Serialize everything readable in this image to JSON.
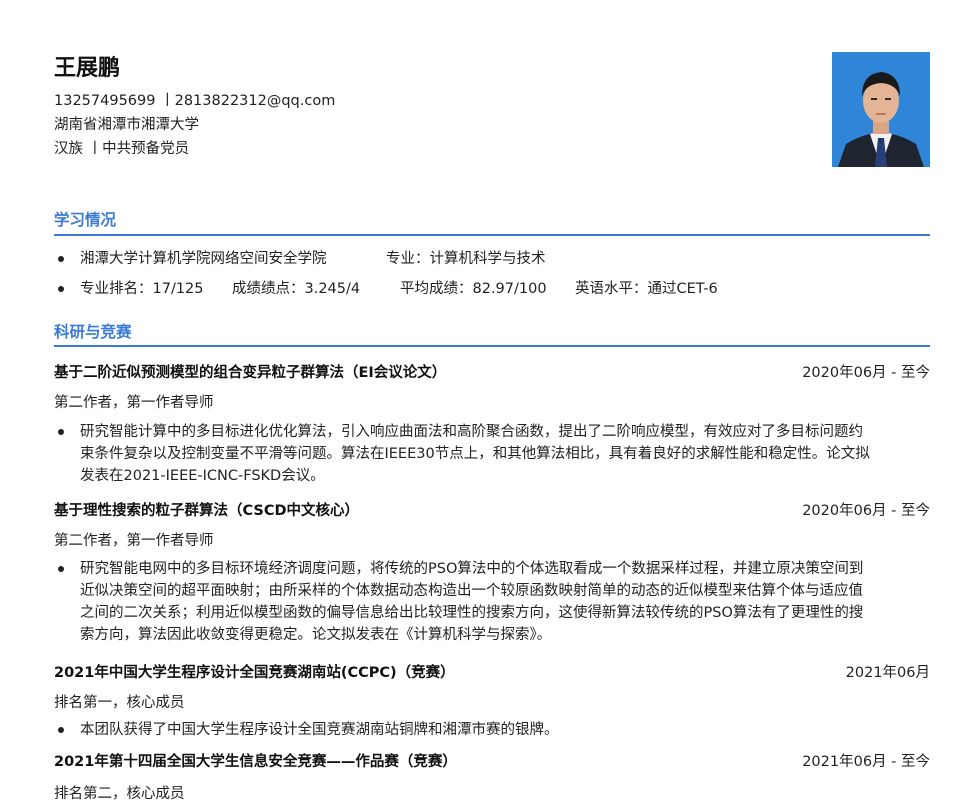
{
  "header": {
    "name": "王展鹏",
    "contact": "13257495699 丨2813822312@qq.com",
    "address": "湖南省湘潭市湘潭大学",
    "identity": "汉族 丨中共预备党员"
  },
  "education": {
    "title": "学习情况",
    "school": "湘潭大学计算机学院网络空间安全学院",
    "major": "专业：计算机科学与技术",
    "rank": "专业排名：17/125",
    "gpa": "成绩绩点：3.245/4",
    "avg": "平均成绩：82.97/100",
    "english": "英语水平：通过CET-6"
  },
  "research": {
    "title": "科研与竞赛",
    "items": [
      {
        "title": "基于二阶近似预测模型的组合变异粒子群算法（EI会议论文）",
        "date": "2020年06月 - 至今",
        "role": "第二作者，第一作者导师",
        "desc_lines": [
          "研究智能计算中的多目标进化优化算法，引入响应曲面法和高阶聚合函数，提出了二阶响应模型，有效应对了多目标问题约",
          "束条件复杂以及控制变量不平滑等问题。算法在IEEE30节点上，和其他算法相比，具有着良好的求解性能和稳定性。论文拟",
          "发表在2021-IEEE-ICNC-FSKD会议。"
        ]
      },
      {
        "title": "基于理性搜索的粒子群算法（CSCD中文核心）",
        "date": "2020年06月 - 至今",
        "role": "第二作者，第一作者导师",
        "desc_lines": [
          "研究智能电网中的多目标环境经济调度问题，将传统的PSO算法中的个体选取看成一个数据采样过程，并建立原决策空间到",
          "近似决策空间的超平面映射；由所采样的个体数据动态构造出一个较原函数映射简单的动态的近似模型来估算个体与适应值",
          "之间的二次关系；利用近似模型函数的偏导信息给出比较理性的搜索方向，这使得新算法较传统的PSO算法有了更理性的搜",
          "索方向，算法因此收敛变得更稳定。论文拟发表在《计算机科学与探索》。"
        ]
      },
      {
        "title": "2021年中国大学生程序设计全国竞赛湖南站(CCPC)（竞赛）",
        "date": "2021年06月",
        "role": "排名第一，核心成员",
        "desc_lines": [
          "本团队获得了中国大学生程序设计全国竞赛湖南站铜牌和湘潭市赛的银牌。"
        ]
      },
      {
        "title": "2021年第十四届全国大学生信息安全竞赛——作品赛（竞赛）",
        "date": "2021年06月 - 至今",
        "role": "排名第二，核心成员",
        "desc_lines": []
      }
    ]
  },
  "colors": {
    "accent": "#3a7bd5",
    "photo_bg": "#2f86d9"
  }
}
